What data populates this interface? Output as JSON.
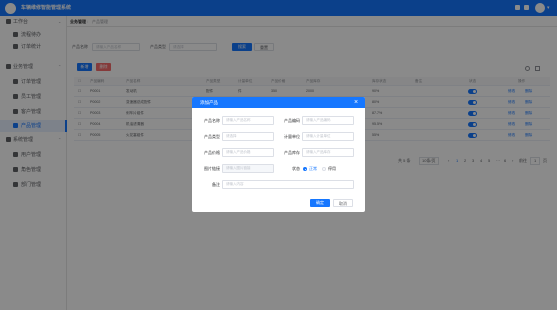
{
  "app": {
    "title": "车辆维修智能管理系统"
  },
  "sidebar": {
    "items": [
      {
        "label": "工作台"
      },
      {
        "label": "流程待办"
      },
      {
        "label": "订单统计"
      },
      {
        "label": "业务管理"
      },
      {
        "label": "订单管理"
      },
      {
        "label": "员工管理"
      },
      {
        "label": "客户管理"
      },
      {
        "label": "产品管理"
      },
      {
        "label": "系统管理"
      },
      {
        "label": "用户管理"
      },
      {
        "label": "角色管理"
      },
      {
        "label": "部门管理"
      }
    ]
  },
  "breadcrumb": {
    "home": "业务管理",
    "current": "产品管理"
  },
  "search": {
    "name_label": "产品名称",
    "name_placeholder": "请输入产品名称",
    "type_label": "产品类型",
    "type_placeholder": "请选择",
    "search_button": "搜索",
    "reset_button": "重置"
  },
  "toolbar": {
    "add_button": "新增",
    "delete_button": "删除"
  },
  "table": {
    "headers": [
      "产品编码",
      "产品名称",
      "产品类型",
      "计量单位",
      "产品价格",
      "产品库存",
      "库存状态",
      "备注",
      "状态",
      "操作"
    ],
    "rows": [
      {
        "code": "P0001",
        "name": "发动机",
        "type": "配件",
        "unit": "件",
        "price": "350",
        "stock": "2000",
        "stock_status": "90%",
        "status": "on"
      },
      {
        "code": "P0002",
        "name": "变速器总成配件",
        "type": "配件",
        "unit": "件",
        "price": "280",
        "stock": "1500",
        "stock_status": "80%",
        "status": "on"
      },
      {
        "code": "P0003",
        "name": "刹车片组件",
        "type": "配件",
        "unit": "套",
        "price": "120",
        "stock": "3200",
        "stock_status": "87.7%",
        "status": "on"
      },
      {
        "code": "P0004",
        "name": "机油滤清器",
        "type": "耗材",
        "unit": "个",
        "price": "45",
        "stock": "5000",
        "stock_status": "95.5%",
        "status": "on"
      },
      {
        "code": "P0005",
        "name": "火花塞组件",
        "type": "耗材",
        "unit": "个",
        "price": "35",
        "stock": "4000",
        "stock_status": "55%",
        "status": "on"
      }
    ],
    "edit_link": "修改",
    "delete_link": "删除"
  },
  "pagination": {
    "total": "共 5 条",
    "page_size": "10条/页",
    "pages": [
      "1",
      "2",
      "3",
      "4",
      "5",
      "6"
    ],
    "ellipsis": "···",
    "goto_label": "前往",
    "goto_value": "1",
    "page_suffix": "页"
  },
  "dialog": {
    "title": "添加产品",
    "close": "×",
    "fields": {
      "name_label": "产品名称",
      "name_placeholder": "请输入产品名称",
      "code_label": "产品编码",
      "code_placeholder": "请输入产品编码",
      "type_label": "产品类型",
      "type_placeholder": "请选择",
      "unit_label": "计量单位",
      "unit_placeholder": "请输入计量单位",
      "price_label": "产品价格",
      "price_placeholder": "请输入产品价格",
      "stock_label": "产品库存",
      "stock_placeholder": "请输入产品库存",
      "image_label": "图片链接",
      "image_placeholder": "请输入图片链接",
      "status_label": "状态",
      "status_on": "正常",
      "status_off": "停用",
      "remark_label": "备注",
      "remark_placeholder": "请输入内容"
    },
    "confirm_button": "确定",
    "cancel_button": "取消"
  },
  "colors": {
    "primary": "#1677ff",
    "danger": "#f56c6c",
    "mask": "rgba(0,0,0,0.46)"
  }
}
